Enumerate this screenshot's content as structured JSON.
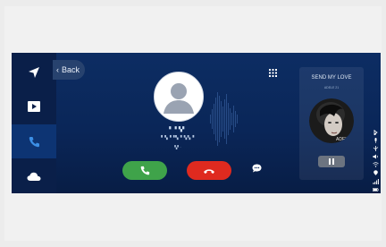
{
  "nav": {
    "back_label": "Back",
    "items": [
      {
        "name": "navigation",
        "icon": "navigation-arrow-icon"
      },
      {
        "name": "media",
        "icon": "media-play-icon"
      },
      {
        "name": "phone",
        "icon": "phone-icon",
        "active": true
      },
      {
        "name": "weather",
        "icon": "cloud-icon"
      }
    ]
  },
  "call": {
    "caller_name": "▘▝ ▚▘",
    "caller_number": "▘▚▝▝▚ ▘▚▚▝",
    "status_text": "▚▘·",
    "answer_icon": "phone-answer-icon",
    "end_icon": "phone-hangup-icon"
  },
  "media": {
    "title": "SEND MY LOVE",
    "artist": "ADELE 21",
    "album_label": "ADELE",
    "control": "pause-icon"
  },
  "colors": {
    "screen_bg": "#0b2a5d",
    "answer": "#3fa34a",
    "end": "#df2a1f",
    "active_tab": "#0d3473"
  }
}
